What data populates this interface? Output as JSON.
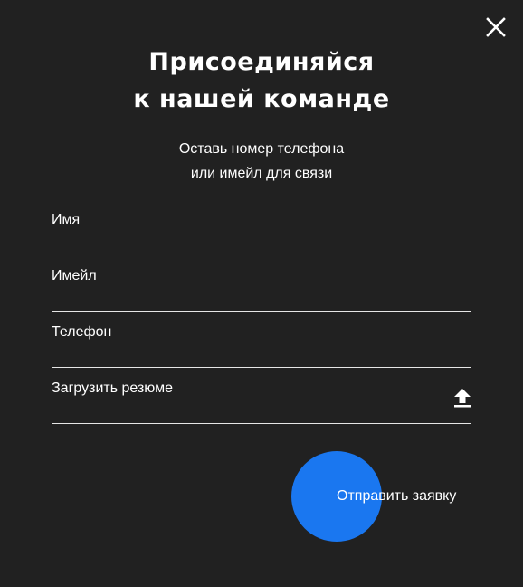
{
  "modal": {
    "title_line1": "Присоединяйся",
    "title_line2": "к нашей команде",
    "subtitle_line1": "Оставь номер телефона",
    "subtitle_line2": "или имейл для связи"
  },
  "form": {
    "name_label": "Имя",
    "email_label": "Имейл",
    "phone_label": "Телефон",
    "resume_label": "Загрузить резюме",
    "name_value": "",
    "email_value": "",
    "phone_value": ""
  },
  "submit": {
    "label": "Отправить заявку"
  },
  "icons": {
    "close": "close-icon",
    "upload": "upload-icon"
  },
  "colors": {
    "background": "#212121",
    "accent": "#1a77f0",
    "text": "#ffffff",
    "divider": "#e6e6e6"
  }
}
